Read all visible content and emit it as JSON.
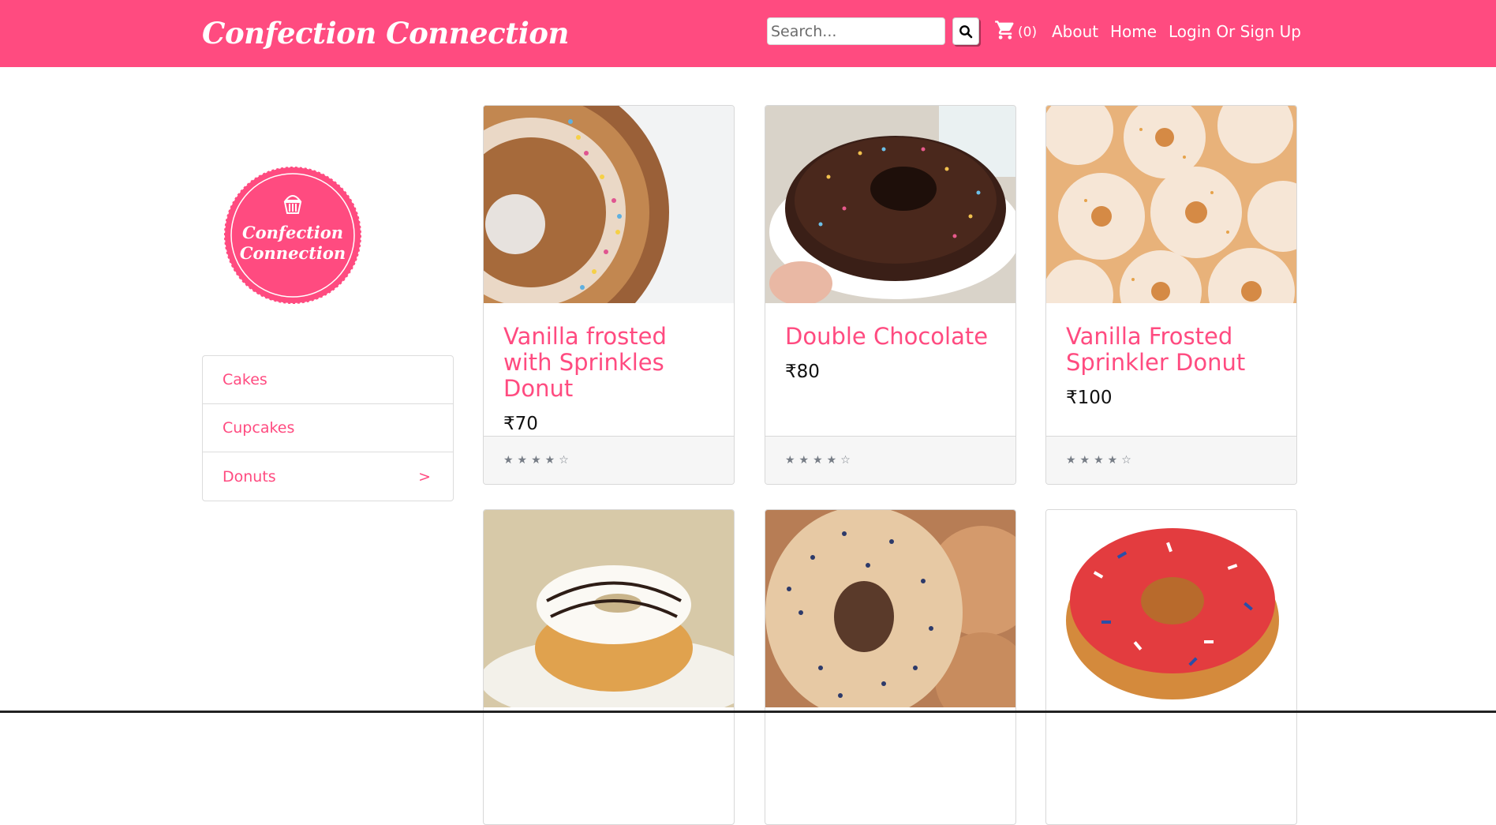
{
  "navbar": {
    "brand": "Confection Connection",
    "search_placeholder": "Search...",
    "search_icon": "search-icon",
    "cart_icon": "cart-icon",
    "cart_count": "(0)",
    "links": [
      "About",
      "Home",
      "Login Or Sign Up"
    ]
  },
  "sidebar": {
    "logo_text_line1": "Confection",
    "logo_text_line2": "Connection",
    "categories": [
      {
        "label": "Cakes",
        "marker": ""
      },
      {
        "label": "Cupcakes",
        "marker": ""
      },
      {
        "label": "Donuts",
        "marker": ">"
      }
    ]
  },
  "products": [
    {
      "title": "Vanilla frosted with Sprinkles Donut",
      "price": "₹70",
      "rating": "★★★★☆"
    },
    {
      "title": "Double Chocolate",
      "price": "₹80",
      "rating": "★★★★☆"
    },
    {
      "title": "Vanilla Frosted Sprinkler Donut",
      "price": "₹100",
      "rating": "★★★★☆"
    }
  ],
  "colors": {
    "brand": "#ff4b80",
    "white": "#ffffff",
    "footer_bg": "#f6f6f6"
  }
}
